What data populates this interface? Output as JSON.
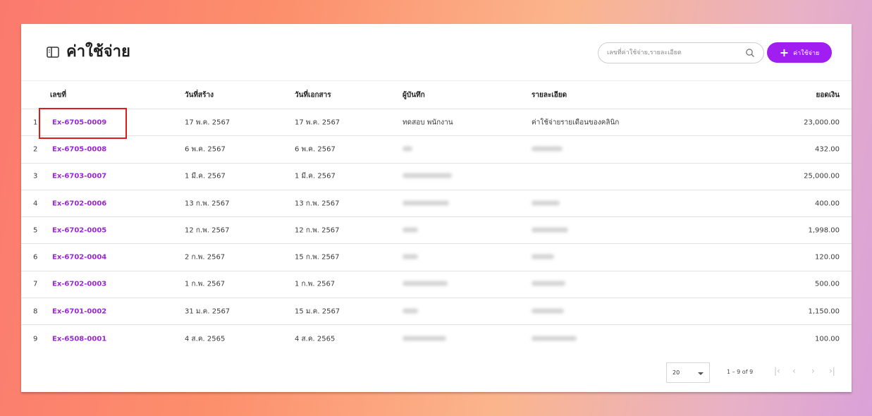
{
  "header": {
    "title": "ค่าใช้จ่าย",
    "search_placeholder": "เลขที่ค่าใช้จ่าย,รายละเอียด",
    "add_button_label": "ค่าใช้จ่าย"
  },
  "table": {
    "columns": [
      "เลขที่",
      "วันที่สร้าง",
      "วันที่เอกสาร",
      "ผู้บันทึก",
      "รายละเอียด",
      "ยอดเงิน"
    ],
    "rows": [
      {
        "index": "1",
        "number": "Ex-6705-0009",
        "created": "17 พ.ค. 2567",
        "doc_date": "17 พ.ค. 2567",
        "recorder": "ทดสอบ พนักงาน",
        "detail": "ค่าใช้จ่ายรายเดือนของคลินิก",
        "amount": "23,000.00"
      },
      {
        "index": "2",
        "number": "Ex-6705-0008",
        "created": "6 พ.ค. 2567",
        "doc_date": "6 พ.ค. 2567",
        "recorder": "",
        "detail": "",
        "amount": "432.00"
      },
      {
        "index": "3",
        "number": "Ex-6703-0007",
        "created": "1 มี.ค. 2567",
        "doc_date": "1 มี.ค. 2567",
        "recorder": "",
        "detail": "",
        "amount": "25,000.00"
      },
      {
        "index": "4",
        "number": "Ex-6702-0006",
        "created": "13 ก.พ. 2567",
        "doc_date": "13 ก.พ. 2567",
        "recorder": "",
        "detail": "",
        "amount": "400.00"
      },
      {
        "index": "5",
        "number": "Ex-6702-0005",
        "created": "12 ก.พ. 2567",
        "doc_date": "12 ก.พ. 2567",
        "recorder": "",
        "detail": "",
        "amount": "1,998.00"
      },
      {
        "index": "6",
        "number": "Ex-6702-0004",
        "created": "2 ก.พ. 2567",
        "doc_date": "15 ก.พ. 2567",
        "recorder": "",
        "detail": "",
        "amount": "120.00"
      },
      {
        "index": "7",
        "number": "Ex-6702-0003",
        "created": "1 ก.พ. 2567",
        "doc_date": "1 ก.พ. 2567",
        "recorder": "",
        "detail": "",
        "amount": "500.00"
      },
      {
        "index": "8",
        "number": "Ex-6701-0002",
        "created": "31 ม.ค. 2567",
        "doc_date": "15 ม.ค. 2567",
        "recorder": "",
        "detail": "",
        "amount": "1,150.00"
      },
      {
        "index": "9",
        "number": "Ex-6508-0001",
        "created": "4 ส.ค. 2565",
        "doc_date": "4 ส.ค. 2565",
        "recorder": "",
        "detail": "",
        "amount": "100.00"
      }
    ]
  },
  "pagination": {
    "page_size": "20",
    "range": "1 – 9 of 9"
  },
  "colors": {
    "accent": "#a01ff0",
    "link": "#9c27d8",
    "highlight_border": "#e01b1b"
  }
}
